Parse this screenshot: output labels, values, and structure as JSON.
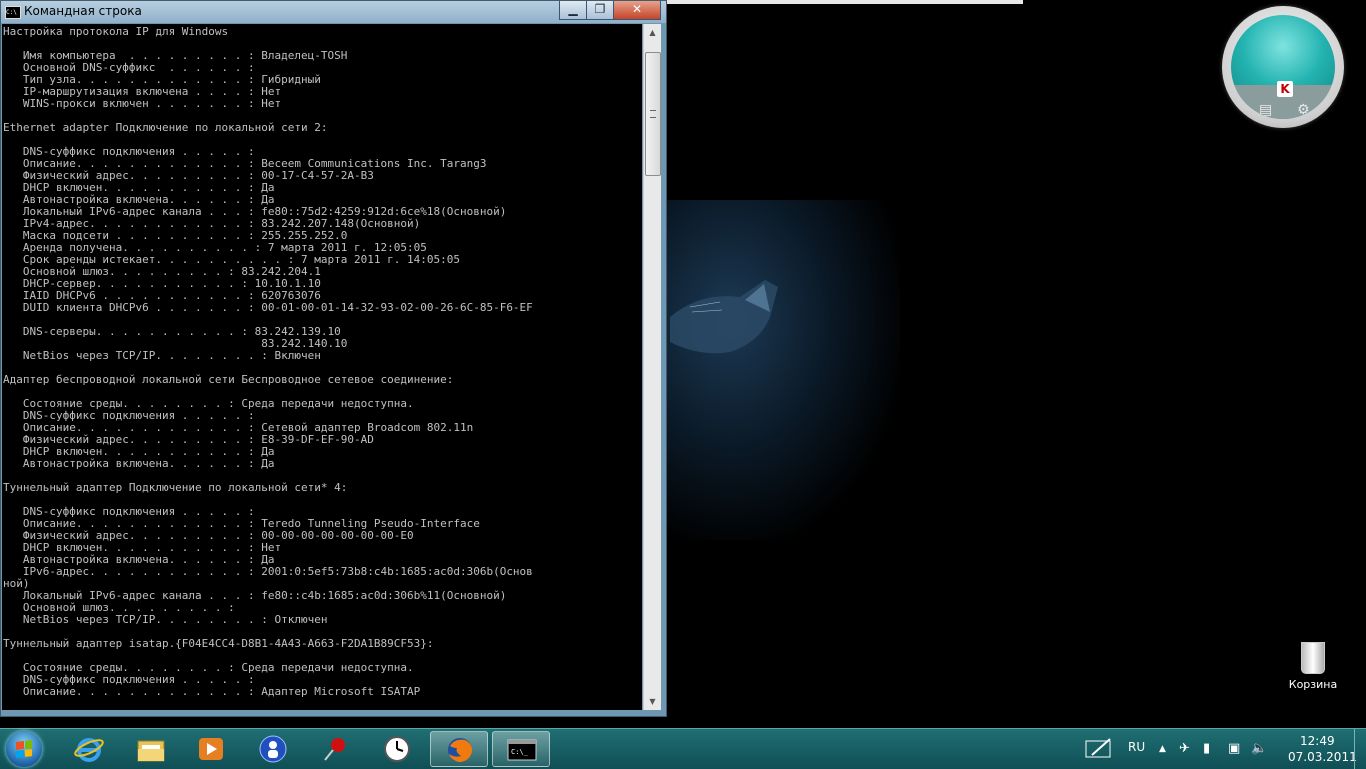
{
  "window": {
    "title": "Командная строка",
    "minimize_label": "▁",
    "maximize_label": "❐",
    "close_label": "✕"
  },
  "console": {
    "lines": [
      "Настройка протокола IP для Windows",
      "",
      "   Имя компьютера  . . . . . . . . . : Владелец-TOSH",
      "   Основной DNS-суффикс  . . . . . . :",
      "   Тип узла. . . . . . . . . . . . . : Гибридный",
      "   IP-маршрутизация включена . . . . : Нет",
      "   WINS-прокси включен . . . . . . . : Нет",
      "",
      "Ethernet adapter Подключение по локальной сети 2:",
      "",
      "   DNS-суффикс подключения . . . . . :",
      "   Описание. . . . . . . . . . . . . : Beceem Communications Inc. Tarang3",
      "   Физический адрес. . . . . . . . . : 00-17-C4-57-2A-B3",
      "   DHCP включен. . . . . . . . . . . : Да",
      "   Автонастройка включена. . . . . . : Да",
      "   Локальный IPv6-адрес канала . . . : fe80::75d2:4259:912d:6ce%18(Основной)",
      "   IPv4-адрес. . . . . . . . . . . . : 83.242.207.148(Основной)",
      "   Маска подсети . . . . . . . . . . : 255.255.252.0",
      "   Аренда получена. . . . . . . . . . : 7 марта 2011 г. 12:05:05",
      "   Срок аренды истекает. . . . . . . . . . : 7 марта 2011 г. 14:05:05",
      "   Основной шлюз. . . . . . . . . : 83.242.204.1",
      "   DHCP-сервер. . . . . . . . . . . : 10.10.1.10",
      "   IAID DHCPv6 . . . . . . . . . . . : 620763076",
      "   DUID клиента DHCPv6 . . . . . . . : 00-01-00-01-14-32-93-02-00-26-6C-85-F6-EF",
      "",
      "   DNS-серверы. . . . . . . . . . . : 83.242.139.10",
      "                                       83.242.140.10",
      "   NetBios через TCP/IP. . . . . . . . : Включен",
      "",
      "Адаптер беспроводной локальной сети Беспроводное сетевое соединение:",
      "",
      "   Состояние среды. . . . . . . . : Среда передачи недоступна.",
      "   DNS-суффикс подключения . . . . . :",
      "   Описание. . . . . . . . . . . . . : Сетевой адаптер Broadcom 802.11n",
      "   Физический адрес. . . . . . . . . : E8-39-DF-EF-90-AD",
      "   DHCP включен. . . . . . . . . . . : Да",
      "   Автонастройка включена. . . . . . : Да",
      "",
      "Туннельный адаптер Подключение по локальной сети* 4:",
      "",
      "   DNS-суффикс подключения . . . . . :",
      "   Описание. . . . . . . . . . . . . : Teredo Tunneling Pseudo-Interface",
      "   Физический адрес. . . . . . . . . : 00-00-00-00-00-00-00-E0",
      "   DHCP включен. . . . . . . . . . . : Нет",
      "   Автонастройка включена. . . . . . : Да",
      "   IPv6-адрес. . . . . . . . . . . . : 2001:0:5ef5:73b8:c4b:1685:ac0d:306b(Основ",
      "ной)",
      "   Локальный IPv6-адрес канала . . . : fe80::c4b:1685:ac0d:306b%11(Основной)",
      "   Основной шлюз. . . . . . . . . :",
      "   NetBios через TCP/IP. . . . . . . . : Отключен",
      "",
      "Туннельный адаптер isatap.{F04E4CC4-D8B1-4A43-A663-F2DA1B89CF53}:",
      "",
      "   Состояние среды. . . . . . . . : Среда передачи недоступна.",
      "   DNS-суффикс подключения . . . . . :",
      "   Описание. . . . . . . . . . . . . : Адаптер Microsoft ISATAP"
    ]
  },
  "desktop": {
    "recycle_bin_label": "Корзина"
  },
  "tray": {
    "language": "RU",
    "time": "12:49",
    "date": "07.03.2011"
  },
  "colors": {
    "taskbar": "#0f4f55",
    "console_bg": "#000000",
    "console_text": "#c0c0c0"
  }
}
